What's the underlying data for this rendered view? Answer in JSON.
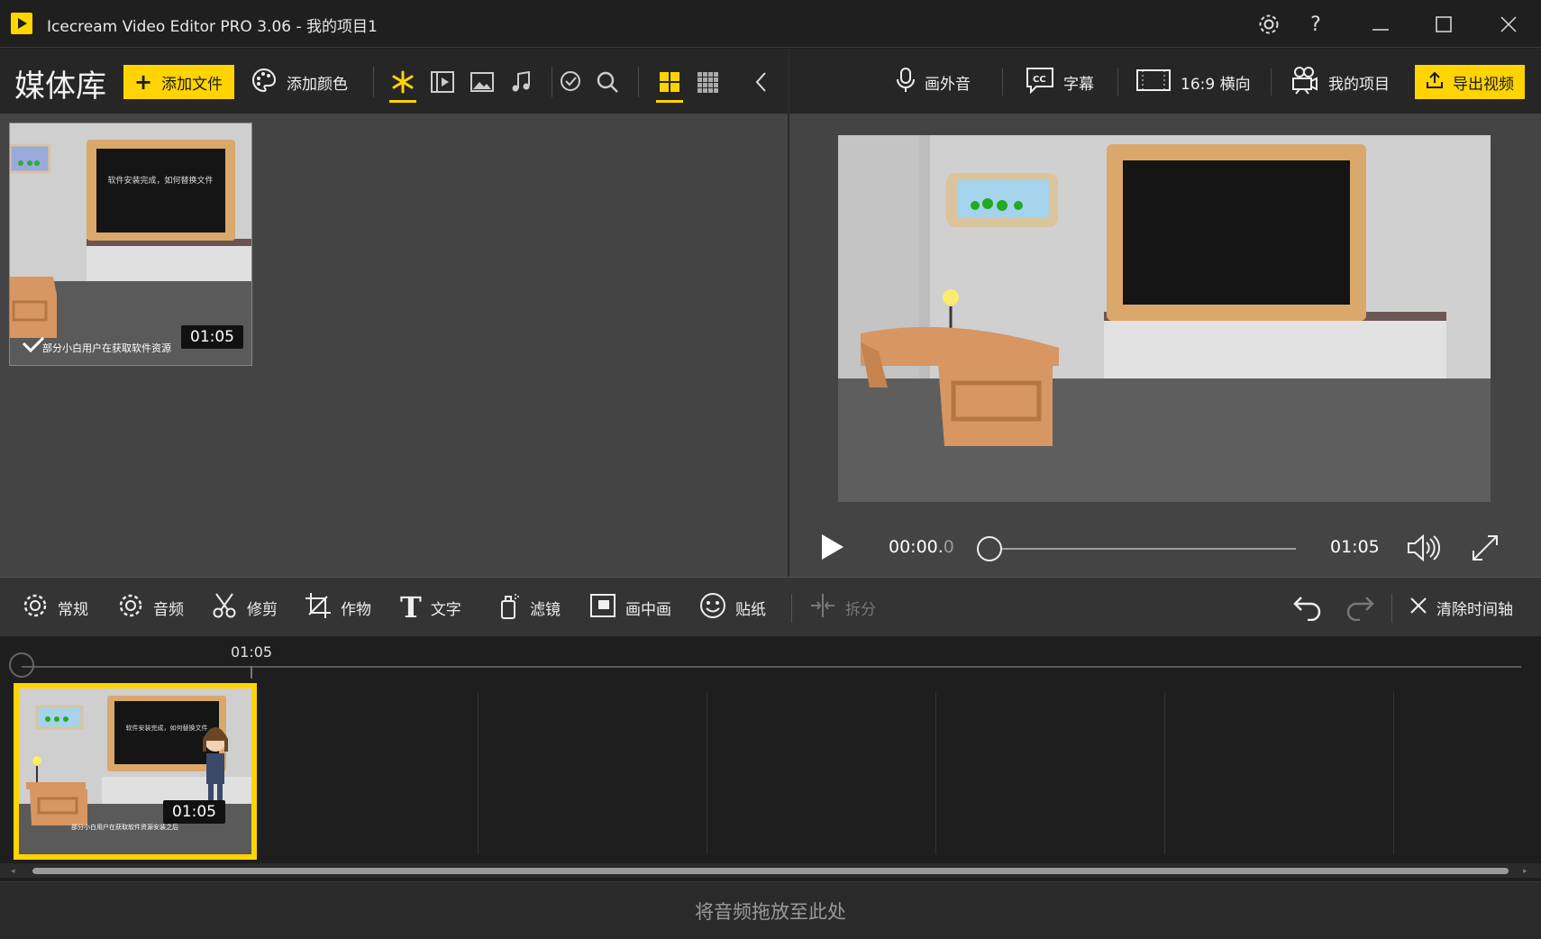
{
  "window": {
    "title": "Icecream Video Editor PRO 3.06   -   我的项目1",
    "controls": [
      "gear-icon",
      "help-icon",
      "minimize-icon",
      "maximize-icon",
      "close-icon"
    ]
  },
  "media_toolbar": {
    "title": "媒体库",
    "add_file": "添加文件",
    "add_color": "添加颜色",
    "filters": [
      "all-star-icon",
      "video-icon",
      "image-icon",
      "music-icon",
      "check-filter-icon",
      "search-icon"
    ],
    "view_modes": [
      "large-grid-icon",
      "small-grid-icon"
    ],
    "collapse": "chevron-left-icon"
  },
  "media_items": [
    {
      "duration": "01:05",
      "caption": "部分小白用户在获取软件资源",
      "board_text": "软件安装完成，如何替换文件",
      "selected": true
    }
  ],
  "right_toolbar": {
    "voiceover": "画外音",
    "subtitles": "字幕",
    "aspect": "16:9 横向",
    "my_projects": "我的项目",
    "export": "导出视频"
  },
  "player": {
    "current_time_main": "00:00.",
    "current_time_frac": "0",
    "total_time": "01:05",
    "progress": 0
  },
  "edit_toolbar": {
    "general": "常规",
    "audio": "音频",
    "trim": "修剪",
    "crop": "作物",
    "text": "文字",
    "filters": "滤镜",
    "pip": "画中画",
    "stickers": "贴纸",
    "split": "拆分",
    "clear_timeline": "清除时间轴"
  },
  "timeline": {
    "ruler_label": "01:05",
    "clip": {
      "duration": "01:05",
      "caption": "部分小白用户在获取软件资源安装之后",
      "board_text": "软件安装完成，如何替换文件"
    }
  },
  "audio_drop": "将音频拖放至此处",
  "colors": {
    "accent": "#ffd400",
    "panel": "#444444",
    "toolbar": "#262626",
    "dark": "#1e1e1e"
  }
}
